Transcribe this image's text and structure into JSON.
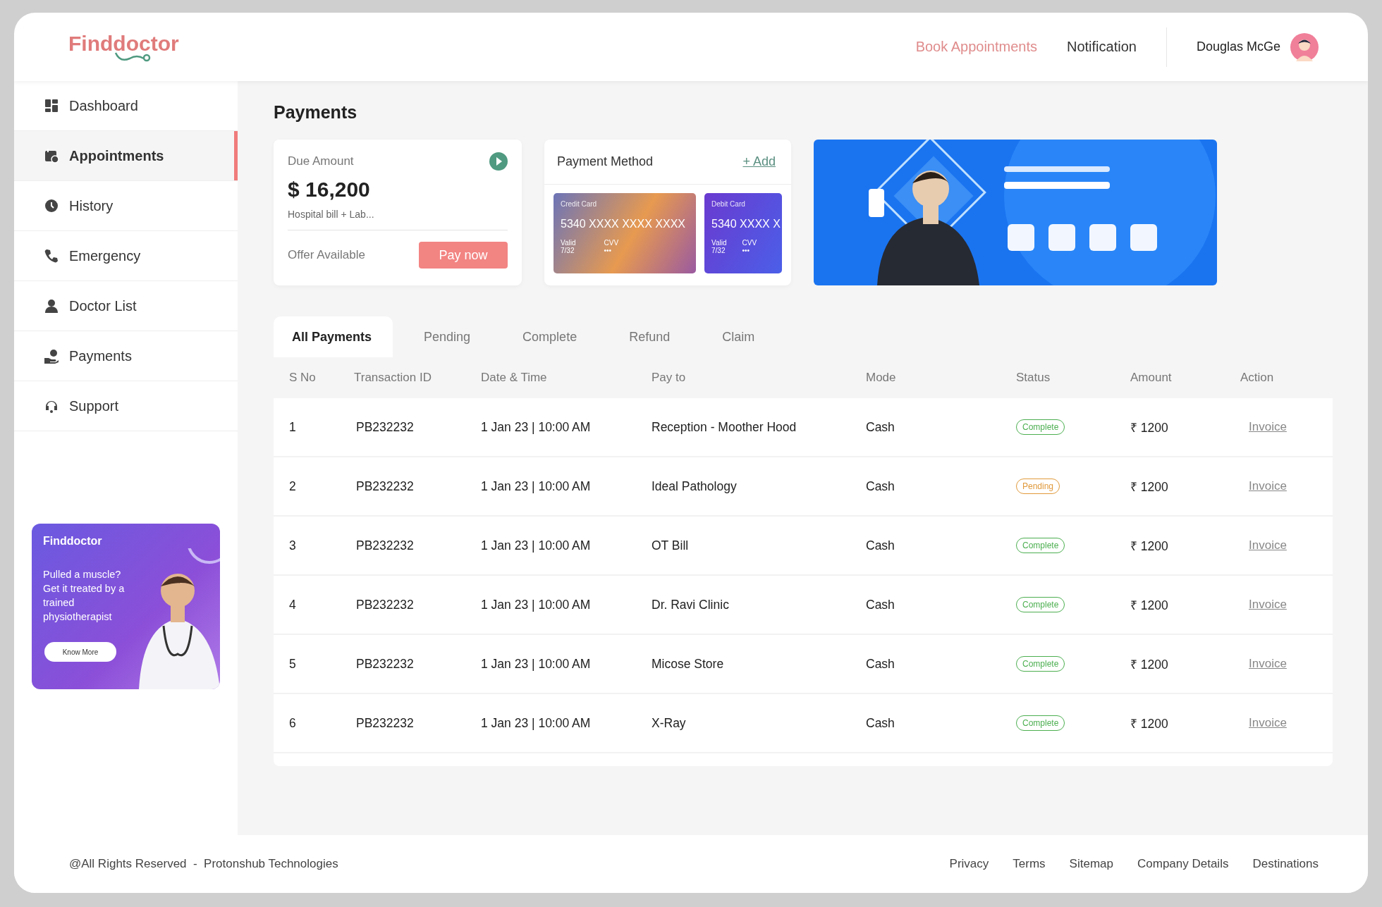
{
  "header": {
    "logo": "Finddoctor",
    "nav": [
      {
        "label": "Book Appointments",
        "selected": true
      },
      {
        "label": "Notification",
        "selected": false
      }
    ],
    "user": "Douglas McGe"
  },
  "sidebar": {
    "items": [
      {
        "label": "Dashboard",
        "selected": false
      },
      {
        "label": "Appointments",
        "selected": true
      },
      {
        "label": "History",
        "selected": false
      },
      {
        "label": "Emergency",
        "selected": false
      },
      {
        "label": "Doctor List",
        "selected": false
      },
      {
        "label": "Payments",
        "selected": false
      },
      {
        "label": "Support",
        "selected": false
      }
    ],
    "promo": {
      "logo": "Finddoctor",
      "text": "Pulled a muscle? Get it treated by a trained physiotherapist",
      "button": "Know More"
    }
  },
  "page_title": "Payments",
  "due_card": {
    "title": "Due Amount",
    "amount": "$ 16,200",
    "note": "Hospital bill + Lab...",
    "offer": "Offer Available",
    "button": "Pay now"
  },
  "payment_method": {
    "title": "Payment Method",
    "add": "+ Add",
    "cards": [
      {
        "kind": "credit",
        "type": "Credit Card",
        "number": "5340 XXXX XXXX XXXX",
        "valid_label": "Valid",
        "valid": "7/32",
        "cvv_label": "CVV",
        "cvv": "•••"
      },
      {
        "kind": "debit",
        "type": "Debit Card",
        "number": "5340 XXXX X",
        "valid_label": "Valid",
        "valid": "7/32",
        "cvv_label": "CVV",
        "cvv": "•••"
      }
    ]
  },
  "tabs": [
    {
      "label": "All Payments",
      "selected": true
    },
    {
      "label": "Pending",
      "selected": false
    },
    {
      "label": "Complete",
      "selected": false
    },
    {
      "label": "Refund",
      "selected": false
    },
    {
      "label": "Claim",
      "selected": false
    }
  ],
  "table": {
    "columns": [
      "S No",
      "Transaction ID",
      "Date & Time",
      "Pay to",
      "Mode",
      "Status",
      "Amount",
      "Action"
    ],
    "rows": [
      {
        "sno": "1",
        "id": "PB232232",
        "date": "1 Jan 23 | 10:00 AM",
        "pay_to": "Reception - Moother Hood",
        "mode": "Cash",
        "status": "Complete",
        "color": "#4caf50",
        "amount": "₹ 1200",
        "action": "Invoice"
      },
      {
        "sno": "2",
        "id": "PB232232",
        "date": "1 Jan 23 | 10:00 AM",
        "pay_to": "Ideal Pathology",
        "mode": "Cash",
        "status": "Pending",
        "color": "#e09a3c",
        "amount": "₹ 1200",
        "action": "Invoice"
      },
      {
        "sno": "3",
        "id": "PB232232",
        "date": "1 Jan 23 | 10:00 AM",
        "pay_to": "OT Bill",
        "mode": "Cash",
        "status": "Complete",
        "color": "#4caf50",
        "amount": "₹ 1200",
        "action": "Invoice"
      },
      {
        "sno": "4",
        "id": "PB232232",
        "date": "1 Jan 23 | 10:00 AM",
        "pay_to": "Dr. Ravi Clinic",
        "mode": "Cash",
        "status": "Complete",
        "color": "#4caf50",
        "amount": "₹ 1200",
        "action": "Invoice"
      },
      {
        "sno": "5",
        "id": "PB232232",
        "date": "1 Jan 23 | 10:00 AM",
        "pay_to": "Micose Store",
        "mode": "Cash",
        "status": "Complete",
        "color": "#4caf50",
        "amount": "₹ 1200",
        "action": "Invoice"
      },
      {
        "sno": "6",
        "id": "PB232232",
        "date": "1 Jan 23 | 10:00 AM",
        "pay_to": "X-Ray",
        "mode": "Cash",
        "status": "Complete",
        "color": "#4caf50",
        "amount": "₹ 1200",
        "action": "Invoice"
      }
    ]
  },
  "footer": {
    "copyright": "@All Rights Reserved  -  Protonshub Technologies",
    "links": [
      "Privacy",
      "Terms",
      "Sitemap",
      "Company Details",
      "Destinations"
    ]
  }
}
